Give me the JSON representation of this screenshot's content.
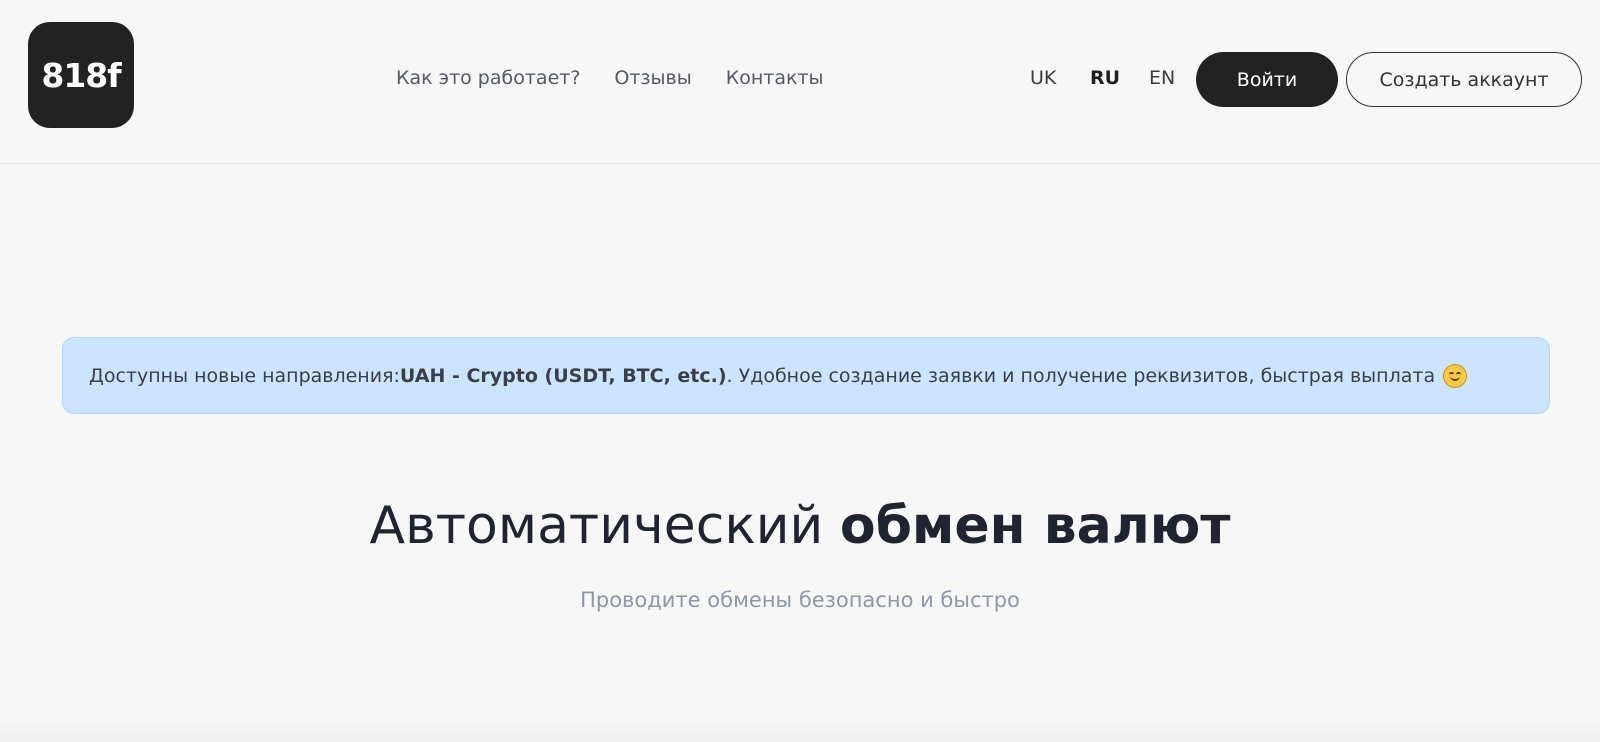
{
  "header": {
    "logo_text": "818f",
    "nav": [
      "Как это работает?",
      "Отзывы",
      "Контакты"
    ],
    "languages": [
      {
        "label": "UK",
        "active": false
      },
      {
        "label": "RU",
        "active": true
      },
      {
        "label": "EN",
        "active": false
      }
    ],
    "login_label": "Войти",
    "create_account_label": "Создать аккаунт"
  },
  "notice": {
    "prefix": "Доступны новые направления: ",
    "highlight": "UAH - Crypto (USDT, BTC, etc.)",
    "suffix": ". Удобное создание заявки и получение реквизитов, быстрая выплата",
    "emoji": "smiling-face-icon"
  },
  "hero": {
    "title_light": "Автоматический ",
    "title_bold": "обмен валют",
    "subtitle": "Проводите обмены безопасно и быстро"
  },
  "colors": {
    "background": "#f7f7f7",
    "dark": "#222222",
    "notice_bg": "#cce4ff",
    "muted_text": "#8e96a8"
  }
}
